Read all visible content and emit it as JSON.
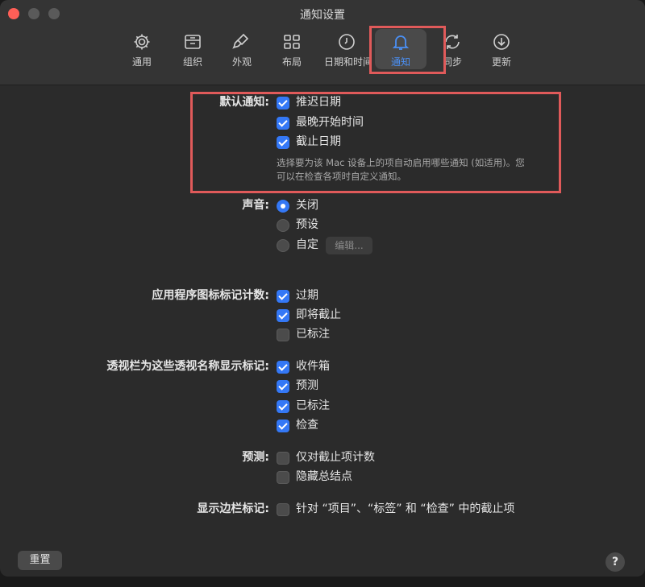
{
  "window": {
    "title": "通知设置"
  },
  "toolbar": [
    {
      "label": "通用",
      "icon": "gear-icon"
    },
    {
      "label": "组织",
      "icon": "tray-icon"
    },
    {
      "label": "外观",
      "icon": "paintbrush-icon"
    },
    {
      "label": "布局",
      "icon": "grid-icon"
    },
    {
      "label": "日期和时间",
      "icon": "clock-icon"
    },
    {
      "label": "通知",
      "icon": "bell-icon",
      "active": true
    },
    {
      "label": "同步",
      "icon": "sync-icon"
    },
    {
      "label": "更新",
      "icon": "download-icon"
    }
  ],
  "default_notifications": {
    "label": "默认通知:",
    "options": [
      {
        "label": "推迟日期",
        "checked": true
      },
      {
        "label": "最晚开始时间",
        "checked": true
      },
      {
        "label": "截止日期",
        "checked": true
      }
    ],
    "note_line1": "选择要为该 Mac 设备上的项自动启用哪些通知 (如适用)。您",
    "note_line2": "可以在检查各项时自定义通知。"
  },
  "sound": {
    "label": "声音:",
    "options": [
      {
        "label": "关闭",
        "selected": true
      },
      {
        "label": "预设",
        "selected": false
      },
      {
        "label": "自定",
        "selected": false
      }
    ],
    "edit_button": "编辑..."
  },
  "badge_count": {
    "label": "应用程序图标标记计数:",
    "options": [
      {
        "label": "过期",
        "checked": true
      },
      {
        "label": "即将截止",
        "checked": true
      },
      {
        "label": "已标注",
        "checked": false
      }
    ]
  },
  "perspective_badges": {
    "label": "透视栏为这些透视名称显示标记:",
    "options": [
      {
        "label": "收件箱",
        "checked": true
      },
      {
        "label": "预测",
        "checked": true
      },
      {
        "label": "已标注",
        "checked": true
      },
      {
        "label": "检查",
        "checked": true
      }
    ]
  },
  "forecast": {
    "label": "预测:",
    "options": [
      {
        "label": "仅对截止项计数",
        "checked": false
      },
      {
        "label": "隐藏总结点",
        "checked": false
      }
    ]
  },
  "sidebar_badges": {
    "label": "显示边栏标记:",
    "options": [
      {
        "label": "针对 “项目”、“标签” 和 “检查” 中的截止项",
        "checked": false
      }
    ]
  },
  "footer": {
    "reset": "重置",
    "help": "?"
  },
  "colors": {
    "accent": "#3478f6",
    "highlight": "#e05a5a"
  }
}
